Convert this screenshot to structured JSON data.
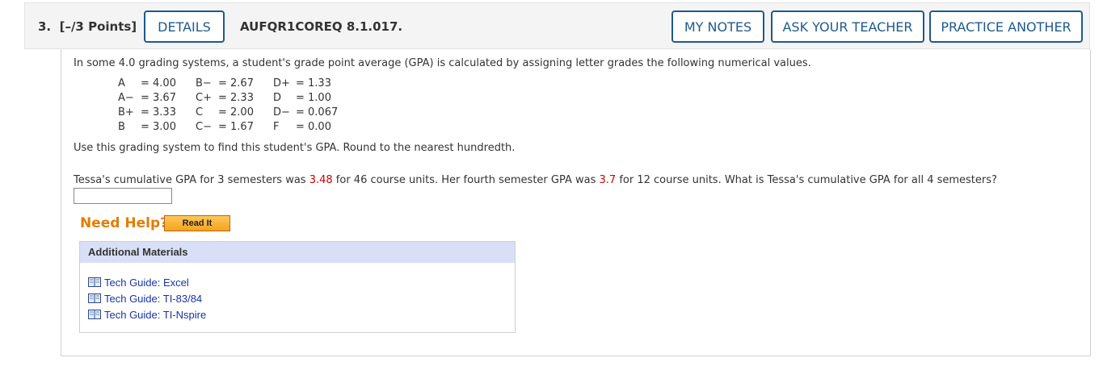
{
  "header": {
    "question_number": "3.",
    "points": "[–/3 Points]",
    "details_label": "DETAILS",
    "question_code": "AUFQR1COREQ 8.1.017.",
    "my_notes_label": "MY NOTES",
    "ask_teacher_label": "ASK YOUR TEACHER",
    "practice_another_label": "PRACTICE ANOTHER"
  },
  "question": {
    "intro": "In some 4.0 grading systems, a student's grade point average (GPA) is calculated by assigning letter grades the following numerical values.",
    "grades": [
      [
        {
          "g": "A",
          "v": "= 4.00"
        },
        {
          "g": "B−",
          "v": "= 2.67"
        },
        {
          "g": "D+",
          "v": "= 1.33"
        }
      ],
      [
        {
          "g": "A−",
          "v": "= 3.67"
        },
        {
          "g": "C+",
          "v": "= 2.33"
        },
        {
          "g": "D",
          "v": "= 1.00"
        }
      ],
      [
        {
          "g": "B+",
          "v": "= 3.33"
        },
        {
          "g": "C",
          "v": "= 2.00"
        },
        {
          "g": "D−",
          "v": "= 0.067"
        }
      ],
      [
        {
          "g": "B",
          "v": "= 3.00"
        },
        {
          "g": "C−",
          "v": "= 1.67"
        },
        {
          "g": "F",
          "v": "= 0.00"
        }
      ]
    ],
    "instruction": "Use this grading system to find this student's GPA. Round to the nearest hundredth.",
    "problem_part1": "Tessa's cumulative GPA for 3 semesters was ",
    "value_gpa1": "3.48",
    "problem_part2": " for 46 course units. Her fourth semester GPA was ",
    "value_gpa2": "3.7",
    "problem_part3": " for 12 course units. What is Tessa's cumulative GPA for all 4 semesters?",
    "answer_value": ""
  },
  "help": {
    "need_help_label": "Need Help?",
    "read_it_label": "Read It"
  },
  "materials": {
    "title": "Additional Materials",
    "items": [
      {
        "label": "Tech Guide: Excel",
        "icon": "book-icon"
      },
      {
        "label": "Tech Guide: TI-83/84",
        "icon": "book-icon"
      },
      {
        "label": "Tech Guide: TI-Nspire",
        "icon": "book-icon"
      }
    ]
  },
  "colors": {
    "accent": "#1f5a8c",
    "highlight": "#d00000",
    "help": "#e47d00",
    "link": "#1a32a8"
  }
}
